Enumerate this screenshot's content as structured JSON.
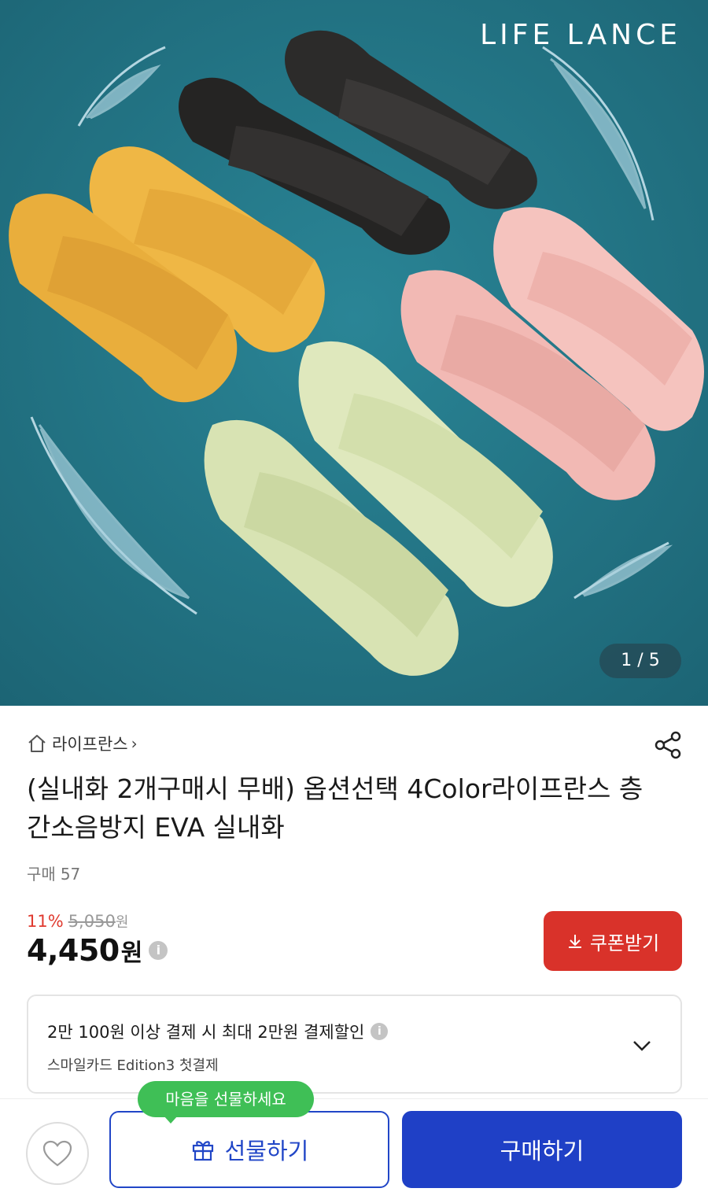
{
  "hero": {
    "brand": "LIFE LANCE",
    "pager": "1 / 5",
    "background_color": "#24798a",
    "sandal_colors": [
      "#e9ae3c",
      "#2c2b2a",
      "#f2b9b4",
      "#d8e3b3"
    ]
  },
  "store": {
    "home_icon": "home-icon",
    "name": "라이프란스",
    "chevron": "›",
    "share_icon": "share-icon"
  },
  "product": {
    "title": "(실내화 2개구매시 무배) 옵션선택 4Color라이프란스 층간소음방지 EVA 실내화",
    "purchase_label": "구매",
    "purchase_count": "57"
  },
  "price": {
    "discount": "11%",
    "original": "5,050",
    "original_unit": "원",
    "current": "4,450",
    "current_unit": "원",
    "info_glyph": "i"
  },
  "coupon": {
    "label": "쿠폰받기",
    "icon": "download-icon",
    "color": "#d9322a"
  },
  "card_promo": {
    "line1": "2만 100원 이상 결제 시 최대 2만원 결제할인",
    "line2": "스마일카드 Edition3 첫결제",
    "info_glyph": "i"
  },
  "bottom_bar": {
    "gift_tooltip": "마음을 선물하세요",
    "gift_label": "선물하기",
    "buy_label": "구매하기",
    "accent_color": "#1f40c6",
    "tooltip_color": "#3fbf56"
  }
}
